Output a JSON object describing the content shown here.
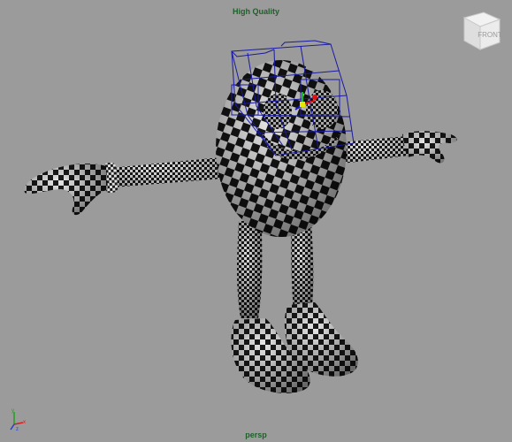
{
  "viewport": {
    "render_mode": "High Quality",
    "camera_name": "persp",
    "background": "#9b9b9b"
  },
  "viewcube": {
    "face_label": "FRONT",
    "icon": "viewcube-icon"
  },
  "axis_indicator": {
    "icon": "axis-gizmo-icon",
    "labels": {
      "x": "x",
      "y": "y",
      "z": "z"
    },
    "colors": {
      "x": "#d02020",
      "y": "#20a020",
      "z": "#2040d0"
    }
  },
  "scene": {
    "object": "egg-character-mesh",
    "texture": "checker",
    "selection_color": "#1a1aa0",
    "manipulator_colors": {
      "x": "#e01010",
      "y": "#10c010",
      "z": "#1010e0"
    }
  }
}
